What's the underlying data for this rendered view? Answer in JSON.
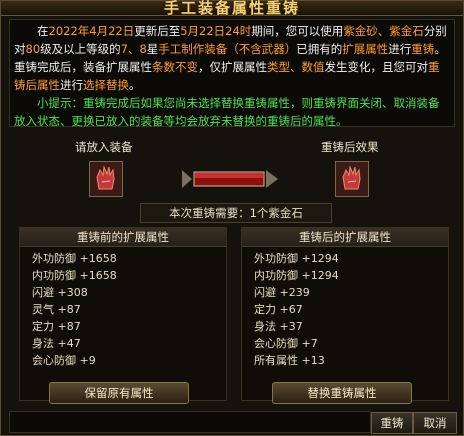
{
  "window": {
    "title": "手工装备属性重铸"
  },
  "info": {
    "p1": [
      {
        "t": "在",
        "c": ""
      },
      {
        "t": "2022年4月22日",
        "c": "orange"
      },
      {
        "t": "更新后至",
        "c": ""
      },
      {
        "t": "5月22日24时",
        "c": "orange"
      },
      {
        "t": "期间，您可以使用",
        "c": ""
      },
      {
        "t": "紫金砂、紫金石",
        "c": "orange"
      },
      {
        "t": "分别对",
        "c": ""
      },
      {
        "t": "80",
        "c": "orange"
      },
      {
        "t": "级及以上等级的",
        "c": ""
      },
      {
        "t": "7、8",
        "c": "orange"
      },
      {
        "t": "星",
        "c": ""
      },
      {
        "t": "手工制作装备（不含武器）",
        "c": "orange"
      },
      {
        "t": "已拥有的",
        "c": ""
      },
      {
        "t": "扩展属性",
        "c": "orange"
      },
      {
        "t": "进行",
        "c": ""
      },
      {
        "t": "重铸",
        "c": "orange"
      },
      {
        "t": "。重铸完成后，装备扩展属性",
        "c": ""
      },
      {
        "t": "条数不变",
        "c": "orange"
      },
      {
        "t": "，仅扩展属性",
        "c": ""
      },
      {
        "t": "类型、数值",
        "c": "orange"
      },
      {
        "t": "发生变化，且您可对",
        "c": ""
      },
      {
        "t": "重铸后属性",
        "c": "orange"
      },
      {
        "t": "进行",
        "c": ""
      },
      {
        "t": "选择替换",
        "c": "orange"
      },
      {
        "t": "。",
        "c": ""
      }
    ],
    "p2": "小提示：重铸完成后如果您尚未选择替换重铸属性，则重铸界面关闭、取消装备放入状态、更换已放入的装备等均会放弃未替换的重铸后的属性。"
  },
  "left_slot_label": "请放入装备",
  "right_slot_label": "重铸后效果",
  "cost": "本次重铸需要：1个紫金石",
  "before": {
    "header": "重铸前的扩展属性",
    "attrs": [
      "外功防御 +1658",
      "内功防御 +1658",
      "闪避 +308",
      "灵气 +87",
      "定力 +87",
      "身法 +47",
      "会心防御 +9"
    ]
  },
  "after": {
    "header": "重铸后的扩展属性",
    "attrs": [
      "外功防御 +1294",
      "内功防御 +1294",
      "闪避 +239",
      "定力 +67",
      "身法 +37",
      "会心防御 +7",
      "所有属性 +13"
    ]
  },
  "buttons": {
    "keep": "保留原有属性",
    "replace": "替换重铸属性",
    "recast": "重铸",
    "cancel": "取消"
  },
  "colors": {
    "highlight": "#ff9c30",
    "tip": "#4fe04f",
    "gold_title": "#f5d27a"
  },
  "icons": {
    "slot_item": "gauntlet-icon",
    "arrow": "arrow-right-icon"
  }
}
